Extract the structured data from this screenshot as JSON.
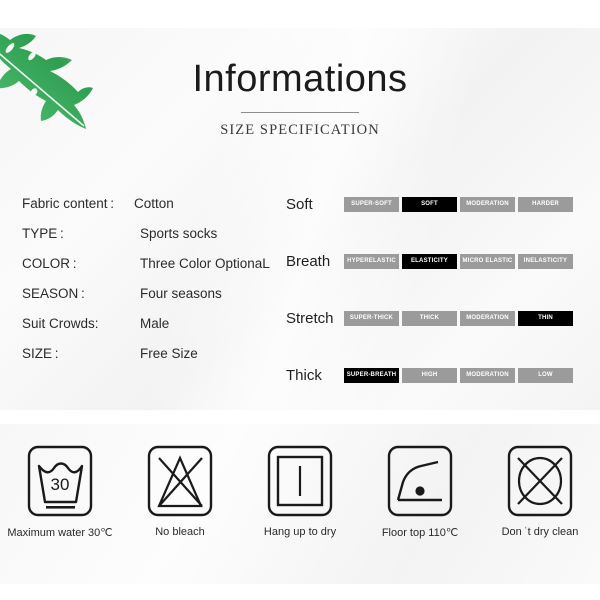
{
  "heading": {
    "title": "Informations",
    "subtitle": "SIZE SPECIFICATION"
  },
  "decoration": {
    "leaf_icon": "monstera-leaf-icon",
    "leaf_color_dark": "#2e9949",
    "leaf_color_light": "#9fd36a"
  },
  "specs": [
    {
      "label": "Fabric content :",
      "value": "Cotton"
    },
    {
      "label": "TYPE :",
      "value": "Sports socks"
    },
    {
      "label": "COLOR :",
      "value": "Three Color OptionaL"
    },
    {
      "label": "SEASON :",
      "value": "Four seasons"
    },
    {
      "label": "Suit Crowds:",
      "value": "Male"
    },
    {
      "label": "SIZE :",
      "value": "Free Size"
    }
  ],
  "ratings": [
    {
      "name": "Soft",
      "chips": [
        {
          "label": "SUPER-SOFT",
          "active": false
        },
        {
          "label": "SOFT",
          "active": true
        },
        {
          "label": "MODERATION",
          "active": false
        },
        {
          "label": "HARDER",
          "active": false
        }
      ]
    },
    {
      "name": "Breath",
      "chips": [
        {
          "label": "HYPERELASTIC",
          "active": false
        },
        {
          "label": "ELASTICITY",
          "active": true
        },
        {
          "label": "MICRO ELASTIC",
          "active": false
        },
        {
          "label": "INELASTICITY",
          "active": false
        }
      ]
    },
    {
      "name": "Stretch",
      "chips": [
        {
          "label": "SUPER-THICK",
          "active": false
        },
        {
          "label": "THICK",
          "active": false
        },
        {
          "label": "MODERATION",
          "active": false
        },
        {
          "label": "THIN",
          "active": true
        }
      ]
    },
    {
      "name": "Thick",
      "chips": [
        {
          "label": "SUPER-BREATH",
          "active": true
        },
        {
          "label": "HIGH",
          "active": false
        },
        {
          "label": "MODERATION",
          "active": false
        },
        {
          "label": "LOW",
          "active": false
        }
      ]
    }
  ],
  "care": [
    {
      "icon": "wash-tub-30-icon",
      "label": "Maximum water 30℃",
      "temp": "30"
    },
    {
      "icon": "no-bleach-triangle-icon",
      "label": "No bleach"
    },
    {
      "icon": "hang-up-to-dry-icon",
      "label": "Hang up to dry"
    },
    {
      "icon": "iron-one-dot-icon",
      "label": "Floor top 110℃"
    },
    {
      "icon": "no-dry-clean-icon",
      "label": "Don ˈt dry clean"
    }
  ],
  "colors": {
    "chip_inactive": "#9b9b9b",
    "chip_active": "#000000",
    "text": "#2b2b2b"
  }
}
